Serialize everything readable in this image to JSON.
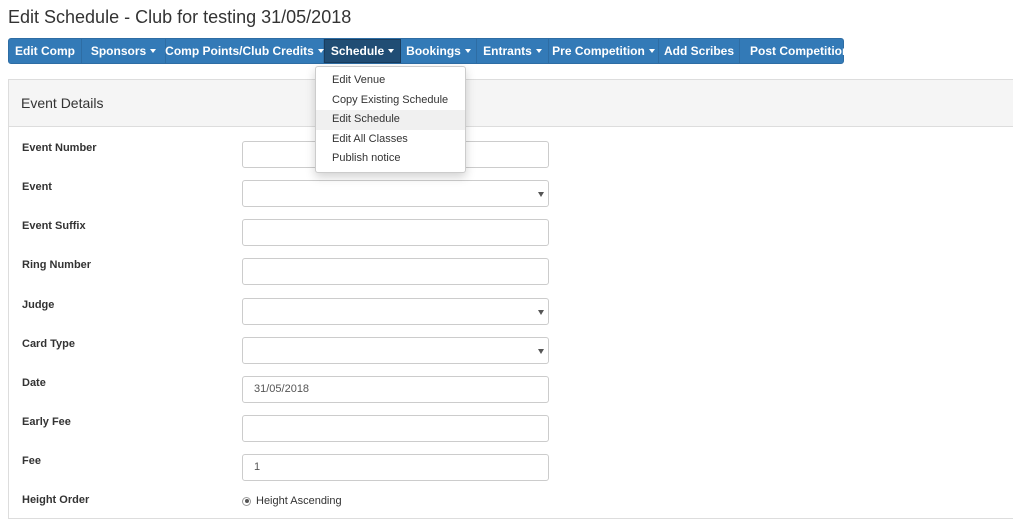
{
  "page": {
    "title": "Edit Schedule - Club for testing 31/05/2018"
  },
  "nav": {
    "items": [
      {
        "label": "Edit Comp",
        "dropdown": false
      },
      {
        "label": "Sponsors",
        "dropdown": true
      },
      {
        "label": "Comp Points/Club Credits",
        "dropdown": true
      },
      {
        "label": "Schedule",
        "dropdown": true,
        "active": true
      },
      {
        "label": "Bookings",
        "dropdown": true
      },
      {
        "label": "Entrants",
        "dropdown": true
      },
      {
        "label": "Pre Competition",
        "dropdown": true
      },
      {
        "label": "Add Scribes",
        "dropdown": false
      },
      {
        "label": "Post Competition",
        "dropdown": true
      }
    ]
  },
  "schedule_menu": {
    "items": [
      {
        "label": "Edit Venue"
      },
      {
        "label": "Copy Existing Schedule"
      },
      {
        "label": "Edit Schedule",
        "highlighted": true
      },
      {
        "label": "Edit All Classes"
      },
      {
        "label": "Publish notice"
      }
    ]
  },
  "panel": {
    "heading": "Event Details"
  },
  "form": {
    "event_number": {
      "label": "Event Number",
      "value": ""
    },
    "event": {
      "label": "Event",
      "value": ""
    },
    "event_suffix": {
      "label": "Event Suffix",
      "value": ""
    },
    "ring_number": {
      "label": "Ring Number",
      "value": ""
    },
    "judge": {
      "label": "Judge",
      "value": ""
    },
    "card_type": {
      "label": "Card Type",
      "value": ""
    },
    "date": {
      "label": "Date",
      "value": "31/05/2018"
    },
    "early_fee": {
      "label": "Early Fee",
      "value": ""
    },
    "fee": {
      "label": "Fee",
      "value": "1"
    },
    "height_order": {
      "label": "Height Order",
      "option": "Height Ascending",
      "selected": true
    }
  },
  "colors": {
    "nav_bg": "#337ab7",
    "nav_active": "#204d74",
    "panel_heading_bg": "#f5f5f5"
  }
}
